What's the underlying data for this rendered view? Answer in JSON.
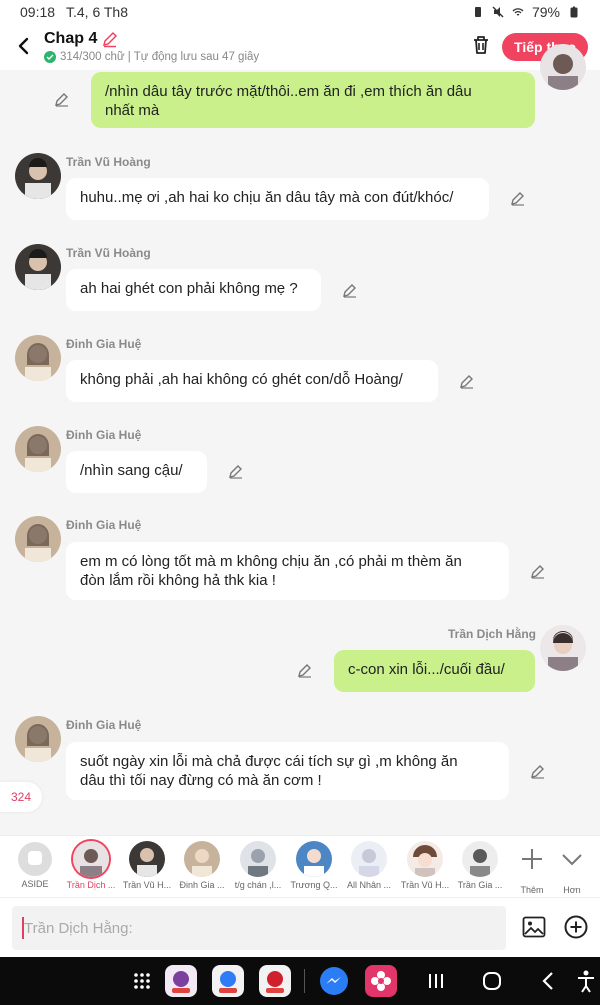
{
  "status_bar": {
    "time": "09:18",
    "date": "T.4, 6 Th8",
    "battery": "79%"
  },
  "header": {
    "title": "Chap 4",
    "subtitle": "314/300 chữ | Tự động lưu sau 47 giây",
    "next_label": "Tiếp theo"
  },
  "messages": [
    {
      "side": "right",
      "sender": "",
      "text_lines": [
        "/nhìn dâu tây trước mặt/thôi..em ăn đi ,em thích ăn dâu",
        "nhất mà"
      ]
    },
    {
      "side": "left",
      "sender": "Trần Vũ Hoàng",
      "text_lines": [
        "huhu..mẹ ơi ,ah hai ko chịu ăn dâu tây mà con đút/khóc/"
      ]
    },
    {
      "side": "left",
      "sender": "Trần Vũ Hoàng",
      "text_lines": [
        "ah hai ghét con phải không mẹ ?"
      ]
    },
    {
      "side": "left",
      "sender": "Đinh Gia Huệ",
      "text_lines": [
        "không phải ,ah hai không có ghét con/dỗ Hoàng/"
      ]
    },
    {
      "side": "left",
      "sender": "Đinh Gia Huệ",
      "text_lines": [
        "/nhìn sang cậu/"
      ]
    },
    {
      "side": "left",
      "sender": "Đinh Gia Huệ",
      "text_lines": [
        "em m có lòng tốt mà m không chịu ăn ,có phải m thèm ăn",
        "đòn lắm rồi không hả thk kia !"
      ]
    },
    {
      "side": "right",
      "sender": "Trần Dịch Hằng",
      "text_lines": [
        "c-con xin lỗi.../cuối đầu/"
      ]
    },
    {
      "side": "left",
      "sender": "Đinh Gia Huệ",
      "text_lines": [
        "suốt ngày xin lỗi mà chả được cái tích sự gì ,m không ăn",
        "dâu thì tối nay đừng có mà ăn cơm !"
      ]
    }
  ],
  "counter": "324",
  "characters": [
    {
      "name": "ASIDE",
      "selected": false,
      "color": "#dddddd"
    },
    {
      "name": "Trần Dịch ...",
      "selected": true,
      "color": "#6d5a55"
    },
    {
      "name": "Trần Vũ H...",
      "selected": false,
      "color": "#4c4a48"
    },
    {
      "name": "Đinh Gia ...",
      "selected": false,
      "color": "#a78c73"
    },
    {
      "name": "t/g chán ,l...",
      "selected": false,
      "color": "#9aa3ad"
    },
    {
      "name": "Trương Q...",
      "selected": false,
      "color": "#4d86c4"
    },
    {
      "name": "All Nhân ...",
      "selected": false,
      "color": "#c7c9d9"
    },
    {
      "name": "Trần Vũ H...",
      "selected": false,
      "color": "#6e4a3a"
    },
    {
      "name": "Trần Gia ...",
      "selected": false,
      "color": "#5a5a5a"
    }
  ],
  "char_actions": {
    "add_label": "Thêm",
    "more_label": "Hơn"
  },
  "input": {
    "placeholder": "Trần Dịch Hằng:"
  },
  "colors": {
    "accent": "#f0435f",
    "green_bubble": "#c9f08a",
    "background": "#f5f5f5"
  }
}
